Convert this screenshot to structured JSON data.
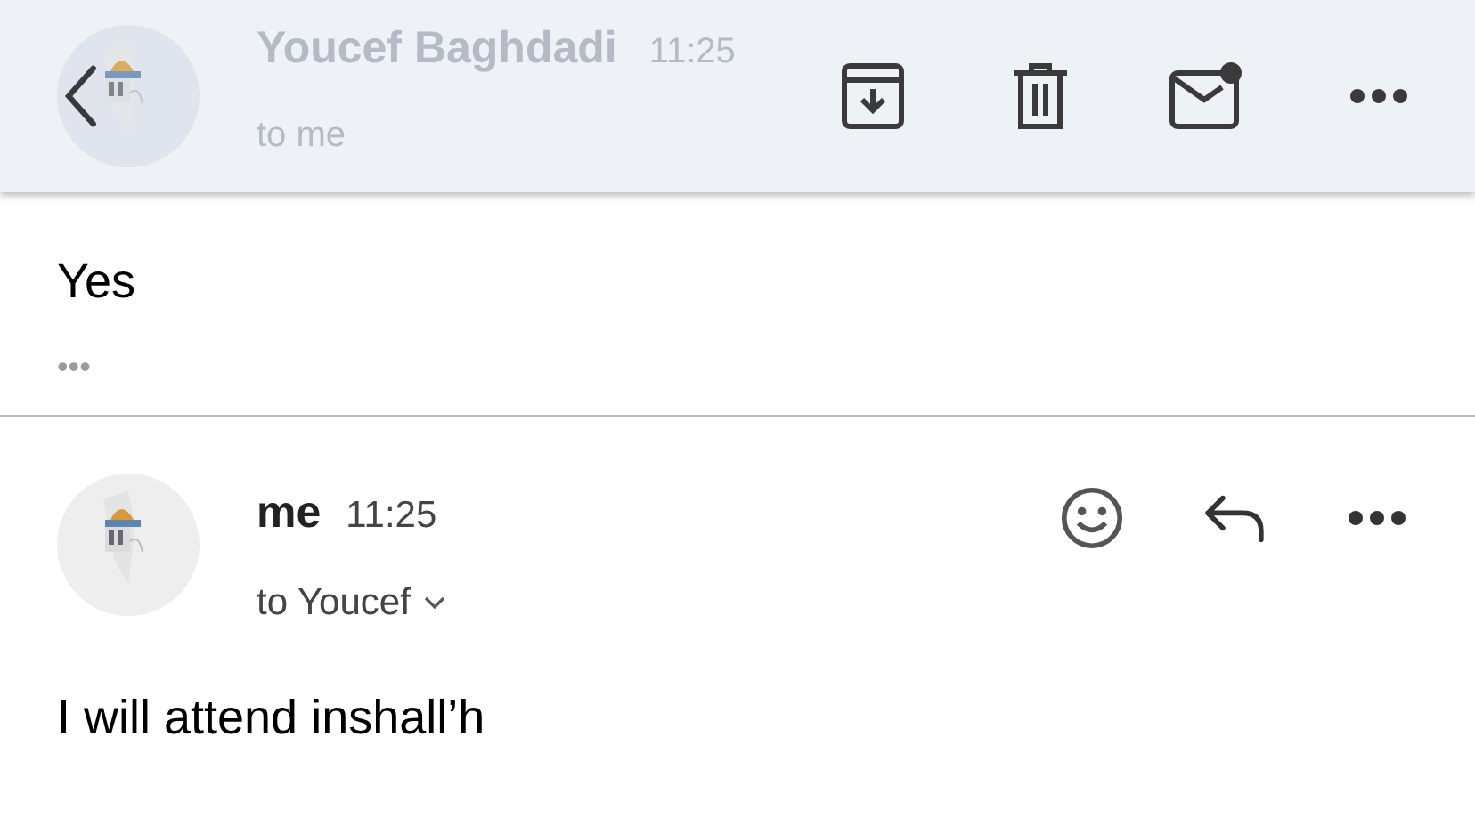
{
  "toolbar": {
    "faded_sender": "Youcef Baghdadi",
    "faded_time": "11:25",
    "faded_recipient": "to me"
  },
  "previous_message": {
    "body": "Yes",
    "more": "•••"
  },
  "message": {
    "sender": "me",
    "time": "11:25",
    "recipient": "to Youcef",
    "body": "I will attend inshall’h"
  }
}
